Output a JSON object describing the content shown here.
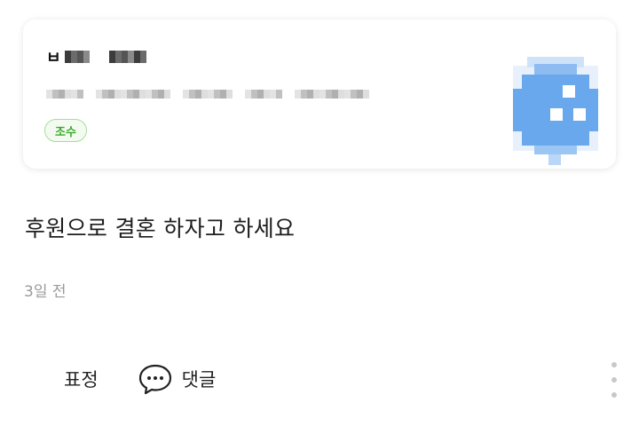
{
  "author": {
    "name_visible_prefix": "ㅂ",
    "badge": "조수"
  },
  "comment": {
    "text": "후원으로 결혼 하자고 하세요",
    "time_ago": "3일 전"
  },
  "actions": {
    "reaction_label": "표정",
    "reply_label": "댓글"
  },
  "colors": {
    "badge_text": "#3aa82c",
    "badge_border": "#a8dc9b",
    "avatar": "#6aa8ee"
  },
  "icons": {
    "reply": "chat-bubble-icon",
    "more": "vertical-ellipsis-icon"
  }
}
